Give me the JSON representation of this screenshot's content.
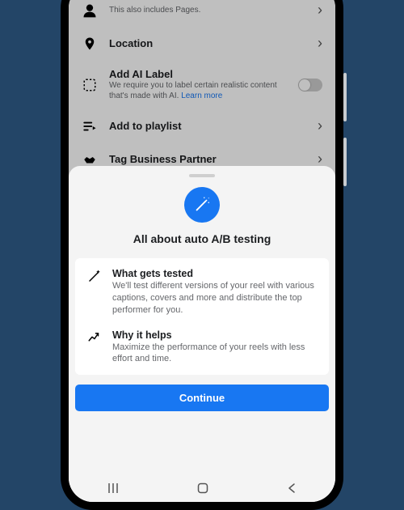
{
  "list": {
    "pagesNote": "This also includes Pages.",
    "location": "Location",
    "aiLabel": {
      "title": "Add AI Label",
      "sub": "We require you to label certain realistic content that's made with AI. ",
      "link": "Learn more"
    },
    "playlist": "Add to playlist",
    "tagBiz": "Tag Business Partner"
  },
  "sheet": {
    "title": "All about auto A/B testing",
    "whatTitle": "What gets tested",
    "whatSub": "We'll test different versions of your reel with various captions, covers and more and distribute the top performer for you.",
    "whyTitle": "Why it helps",
    "whySub": "Maximize the performance of your reels with less effort and time.",
    "cta": "Continue"
  }
}
